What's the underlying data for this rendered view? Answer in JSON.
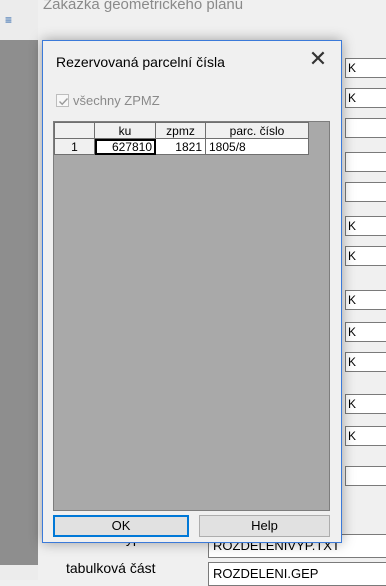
{
  "background": {
    "window_title": "Zakázka geometrického plánu",
    "field_values": [
      "K",
      "K",
      "",
      "",
      "",
      "K",
      "K",
      "K",
      "K",
      "K",
      "K",
      "K",
      ""
    ],
    "bottom_rows": [
      {
        "label": "záznam výpočtu",
        "value": "ROZDELENIVYP.TXT"
      },
      {
        "label": "tabulková část",
        "value": "ROZDELENI.GEP"
      }
    ]
  },
  "dialog": {
    "title": "Rezervovaná parcelní čísla",
    "close_glyph": "✕",
    "checkbox": {
      "label": "všechny ZPMZ",
      "checked": true,
      "enabled": false
    },
    "table": {
      "headers": [
        "",
        "ku",
        "zpmz",
        "parc. číslo"
      ],
      "rows": [
        {
          "index": "1",
          "ku": "627810",
          "zpmz": "1821",
          "parc": "1805/8"
        }
      ]
    },
    "buttons": {
      "ok": "OK",
      "help": "Help"
    }
  }
}
